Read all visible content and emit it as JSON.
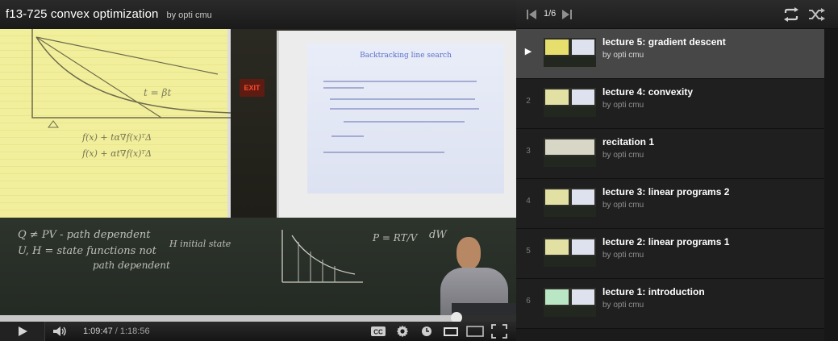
{
  "video": {
    "title": "f13-725 convex optimization",
    "byline": "by opti cmu"
  },
  "scene": {
    "slide_title": "Backtracking line search",
    "exit_sign": "EXIT",
    "chalk_1": "t = βt",
    "chalk_2": "f(x) + tα∇f(x)ᵀΔ",
    "chalk_3": "f(x) + αt∇f(x)ᵀΔ",
    "chalk_4": "Q ≠ PV - path dependent",
    "chalk_5": "U, H = state functions not",
    "chalk_6": "path dependent",
    "chalk_7": "H initial state",
    "chalk_8": "P = RT/V",
    "chalk_9": "dW"
  },
  "controls": {
    "current_time": "1:09:47",
    "separator": " / ",
    "duration": "1:18:56",
    "progress": 0.884
  },
  "playlist": {
    "position": "1/6",
    "items": [
      {
        "index": "▶",
        "title": "lecture 5: gradient descent",
        "author": "by opti cmu",
        "active": true
      },
      {
        "index": "2",
        "title": "lecture 4: convexity",
        "author": "by opti cmu"
      },
      {
        "index": "3",
        "title": "recitation 1",
        "author": "by opti cmu"
      },
      {
        "index": "4",
        "title": "lecture 3: linear programs 2",
        "author": "by opti cmu"
      },
      {
        "index": "5",
        "title": "lecture 2: linear programs 1",
        "author": "by opti cmu"
      },
      {
        "index": "6",
        "title": "lecture 1: introduction",
        "author": "by opti cmu"
      }
    ]
  },
  "icons": {
    "play": "play-icon",
    "volume": "volume-icon",
    "captions": "captions-icon",
    "settings": "gear-icon",
    "watch_later": "clock-icon",
    "small_player": "small-player-icon",
    "large_player": "large-player-icon",
    "fullscreen": "fullscreen-icon",
    "prev": "skip-previous-icon",
    "next": "skip-next-icon",
    "loop": "loop-icon",
    "shuffle": "shuffle-icon"
  },
  "colors": {
    "accent": "#ffffff",
    "active_item_bg": "#474747",
    "progress_fill": "#c8c8c8"
  }
}
